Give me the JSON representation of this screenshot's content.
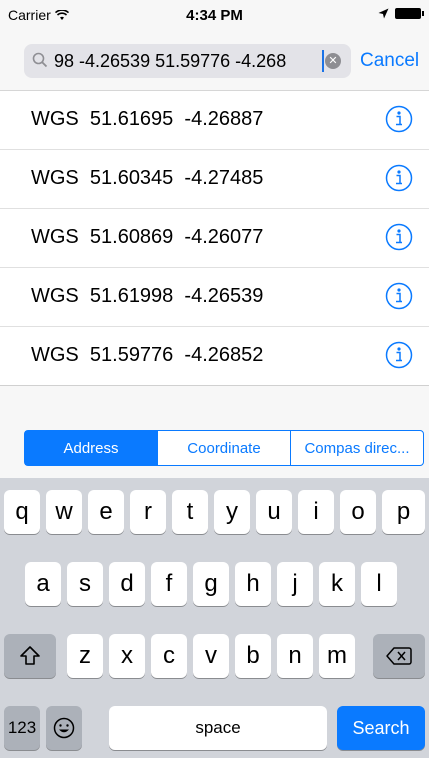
{
  "status_bar": {
    "carrier": "Carrier",
    "time": "4:34 PM"
  },
  "search": {
    "value": "98 -4.26539 51.59776 -4.268",
    "cancel_label": "Cancel"
  },
  "results": [
    {
      "label": "WGS  51.61695  -4.26887"
    },
    {
      "label": "WGS  51.60345  -4.27485"
    },
    {
      "label": "WGS  51.60869  -4.26077"
    },
    {
      "label": "WGS  51.61998  -4.26539"
    },
    {
      "label": "WGS  51.59776  -4.26852"
    }
  ],
  "segments": [
    {
      "label": "Address",
      "active": true
    },
    {
      "label": "Coordinate",
      "active": false
    },
    {
      "label": "Compas direc...",
      "active": false
    }
  ],
  "keyboard": {
    "row1": [
      "q",
      "w",
      "e",
      "r",
      "t",
      "y",
      "u",
      "i",
      "o",
      "p"
    ],
    "row2": [
      "a",
      "s",
      "d",
      "f",
      "g",
      "h",
      "j",
      "k",
      "l"
    ],
    "row3": [
      "z",
      "x",
      "c",
      "v",
      "b",
      "n",
      "m"
    ],
    "numbers_label": "123",
    "space_label": "space",
    "search_label": "Search"
  },
  "colors": {
    "accent": "#0a7aff",
    "keyboard_bg": "#d1d4da"
  }
}
